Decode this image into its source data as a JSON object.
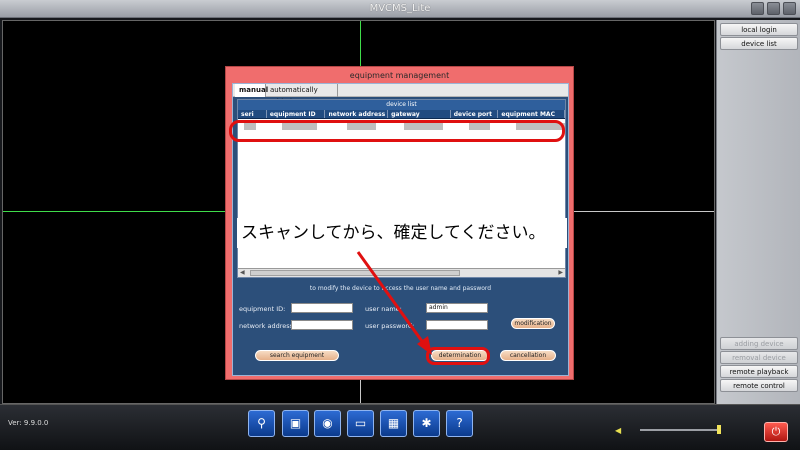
{
  "window": {
    "title": "MVCMS_Lite"
  },
  "right_panel": {
    "local_login": "local login",
    "device_list": "device list",
    "adding_device": "adding device",
    "removal_device": "removal device",
    "remote_playback": "remote playback",
    "remote_control": "remote control"
  },
  "bottom": {
    "version": "Ver: 9.9.0.0"
  },
  "dialog": {
    "title": "equipment management",
    "tab_manual": "manual",
    "tab_auto": "automatically added",
    "list_caption": "device list",
    "columns": [
      "seri",
      "equipment ID",
      "network address",
      "gateway",
      "device port",
      "equipment MAC"
    ],
    "hint": "to modify the device to access the user name and password",
    "equipment_id_label": "equipment ID:",
    "network_address_label": "network address:",
    "user_name_label": "user name:",
    "user_password_label": "user password:",
    "user_name_value": "admin",
    "modification": "modification",
    "search_equipment": "search equipment",
    "determination": "determination",
    "cancellation": "cancellation"
  },
  "annotation": {
    "note": "スキャンしてから、確定してください。"
  }
}
